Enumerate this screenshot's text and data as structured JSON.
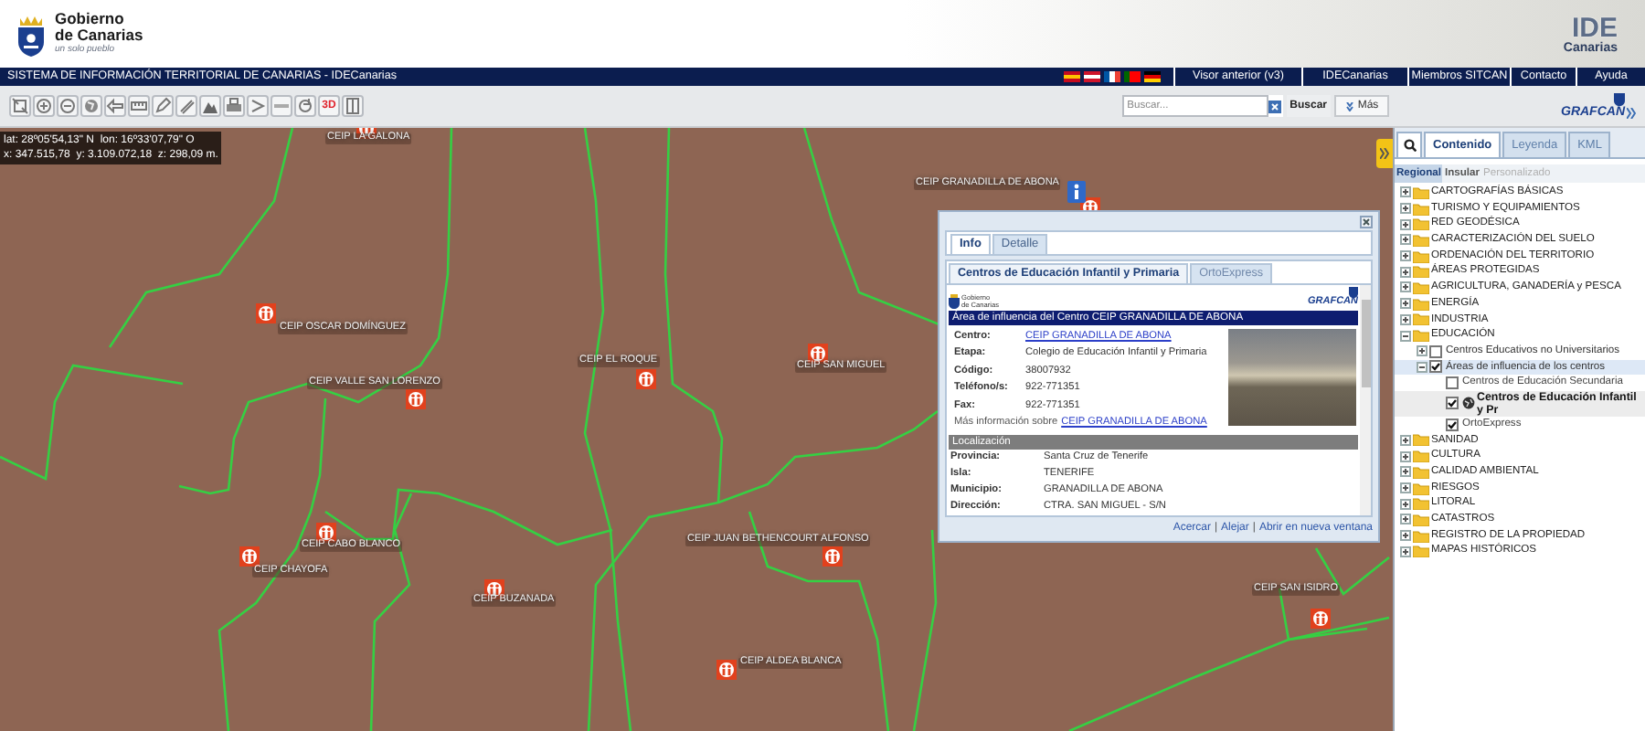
{
  "header": {
    "brand_line_1": "Gobierno",
    "brand_line_2": "de Canarias",
    "slogan": "un solo pueblo",
    "ide_logo": "IDE",
    "ide_logo_sub": "Canarias"
  },
  "nav_bar": {
    "title": "SISTEMA DE INFORMACIÓN TERRITORIAL DE CANARIAS - IDECanarias",
    "links": [
      "Visor anterior (v3)",
      "IDECanarias",
      "Miembros SITCAN",
      "Contacto",
      "Ayuda"
    ]
  },
  "toolbar": {
    "text_tool": "3D",
    "search": {
      "placeholder": "Buscar..."
    },
    "search_button": "Buscar",
    "more_button": "Más",
    "logo": "GRAFCAN"
  },
  "coordinates": {
    "line_1": "lat: 28º05'54,13\" N  lon: 16º33'07,79\" O",
    "line_2": "x: 347.515,78  y: 3.109.072,18  z: 298,09 m."
  },
  "map_labels": [
    {
      "label": "CEIP LA GALONA"
    },
    {
      "label": "CEIP OSCAR DOMÍNGUEZ"
    },
    {
      "label": "CEIP VALLE SAN LORENZO"
    },
    {
      "label": "CEIP EL ROQUE"
    },
    {
      "label": "CEIP SAN MIGUEL"
    },
    {
      "label": "CEIP CABO BLANCO"
    },
    {
      "label": "CEIP CHAYOFA"
    },
    {
      "label": "CEIP BUZANADA"
    },
    {
      "label": "CEIP JUAN BETHENCOURT ALFONSO"
    },
    {
      "label": "CEIP ALDEA BLANCA"
    },
    {
      "label": "CEIP GRANADILLA DE ABONA"
    },
    {
      "label": "CEIP SAN ISIDRO"
    }
  ],
  "popup": {
    "tabs": [
      {
        "label": "Info",
        "selected": true
      },
      {
        "label": "Detalle",
        "selected": false
      }
    ],
    "subtabs": [
      {
        "label": "Centros de Educación Infantil y Primaria",
        "selected": true
      },
      {
        "label": "OrtoExpress",
        "selected": false
      }
    ],
    "org_logo_line_1": "Gobierno",
    "org_logo_line_2": "de Canarias",
    "grafcan_logo": "GRAFCAN",
    "title": "Área de influencia del Centro CEIP GRANADILLA DE ABONA",
    "fields": [
      {
        "label": "Centro:",
        "value": "CEIP GRANADILLA DE ABONA",
        "link": true
      },
      {
        "label": "Etapa:",
        "value": "Colegio de Educación Infantil y Primaria",
        "link": false
      },
      {
        "label": "Código:",
        "value": "38007932",
        "link": false
      },
      {
        "label": "Teléfono/s:",
        "value": "922-771351",
        "link": false
      },
      {
        "label": "Fax:",
        "value": "922-771351",
        "link": false
      }
    ],
    "more_info": {
      "text": "Más información sobre",
      "link": "CEIP GRANADILLA DE ABONA"
    },
    "section": "Localización",
    "location_fields": [
      {
        "label": "Provincia:",
        "value": "Santa Cruz de Tenerife"
      },
      {
        "label": "Isla:",
        "value": "TENERIFE"
      },
      {
        "label": "Municipio:",
        "value": "GRANADILLA DE ABONA"
      },
      {
        "label": "Dirección:",
        "value": "CTRA. SAN MIGUEL - S/N"
      }
    ],
    "footer_links": [
      "Acercar",
      "Alejar",
      "Abrir en nueva ventana"
    ],
    "footer_separator": "|"
  },
  "panel": {
    "tabs": [
      {
        "label": "Contenido",
        "selected": true
      },
      {
        "label": "Leyenda",
        "selected": false
      },
      {
        "label": "KML",
        "selected": false
      }
    ],
    "subtabs": [
      {
        "label": "Regional",
        "selected": true,
        "disabled": false
      },
      {
        "label": "Insular",
        "selected": false,
        "disabled": false
      },
      {
        "label": "Personalizado",
        "selected": false,
        "disabled": true
      }
    ],
    "tree": [
      {
        "kind": "folder",
        "label": "CARTOGRAFÍAS BÁSICAS",
        "expanded": false
      },
      {
        "kind": "folder",
        "label": "TURISMO Y EQUIPAMIENTOS",
        "expanded": false
      },
      {
        "kind": "folder",
        "label": "RED GEODÉSICA",
        "expanded": false
      },
      {
        "kind": "folder",
        "label": "CARACTERIZACIÓN DEL SUELO",
        "expanded": false
      },
      {
        "kind": "folder",
        "label": "ORDENACIÓN DEL TERRITORIO",
        "expanded": false
      },
      {
        "kind": "folder",
        "label": "ÁREAS PROTEGIDAS",
        "expanded": false
      },
      {
        "kind": "folder",
        "label": "AGRICULTURA, GANADERÍA y PESCA",
        "expanded": false
      },
      {
        "kind": "folder",
        "label": "ENERGÍA",
        "expanded": false
      },
      {
        "kind": "folder",
        "label": "INDUSTRIA",
        "expanded": false
      },
      {
        "kind": "folder",
        "label": "EDUCACIÓN",
        "expanded": true,
        "children": [
          {
            "kind": "group",
            "label": "Centros Educativos no Universitarios",
            "expanded": false,
            "checked": false,
            "selected": false
          },
          {
            "kind": "group",
            "label": "Áreas de influencia de los centros",
            "expanded": true,
            "checked": true,
            "selected": true,
            "children": [
              {
                "kind": "layer",
                "label": "Centros de Educación Secundaria",
                "checked": false,
                "active": false
              },
              {
                "kind": "layer",
                "label": "Centros de Educación Infantil y Pr",
                "checked": true,
                "active": true
              },
              {
                "kind": "layer",
                "label": "OrtoExpress",
                "checked": true,
                "active": false
              }
            ]
          }
        ]
      },
      {
        "kind": "folder",
        "label": "SANIDAD",
        "expanded": false
      },
      {
        "kind": "folder",
        "label": "CULTURA",
        "expanded": false
      },
      {
        "kind": "folder",
        "label": "CALIDAD AMBIENTAL",
        "expanded": false
      },
      {
        "kind": "folder",
        "label": "RIESGOS",
        "expanded": false
      },
      {
        "kind": "folder",
        "label": "LITORAL",
        "expanded": false
      },
      {
        "kind": "folder",
        "label": "CATASTROS",
        "expanded": false
      },
      {
        "kind": "folder",
        "label": "REGISTRO DE LA PROPIEDAD",
        "expanded": false
      },
      {
        "kind": "folder",
        "label": "MAPAS HISTÓRICOS",
        "expanded": false
      }
    ]
  }
}
